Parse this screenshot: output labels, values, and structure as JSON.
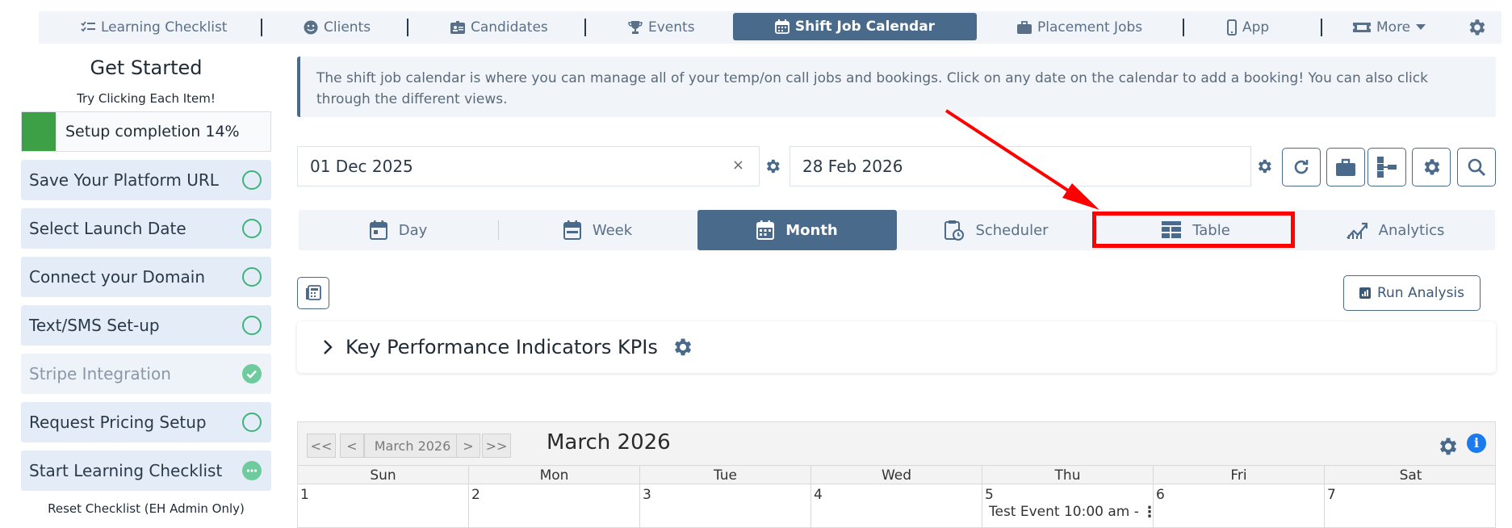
{
  "nav": {
    "items": [
      {
        "label": "Learning Checklist",
        "icon": "checklist-icon"
      },
      {
        "label": "Clients",
        "icon": "smiley-icon"
      },
      {
        "label": "Candidates",
        "icon": "id-card-icon"
      },
      {
        "label": "Events",
        "icon": "trophy-icon"
      },
      {
        "label": "Shift Job Calendar",
        "icon": "calendar-icon"
      },
      {
        "label": "Placement Jobs",
        "icon": "briefcase-icon"
      },
      {
        "label": "App",
        "icon": "mobile-icon"
      },
      {
        "label": "More",
        "icon": "ticket-icon"
      }
    ]
  },
  "sidebar": {
    "title": "Get Started",
    "subtitle": "Try Clicking Each Item!",
    "setup_completion": {
      "label": "Setup completion 14%",
      "percent": 14
    },
    "items": [
      {
        "label": "Save Your Platform URL",
        "status": "pending"
      },
      {
        "label": "Select Launch Date",
        "status": "pending"
      },
      {
        "label": "Connect your Domain",
        "status": "pending"
      },
      {
        "label": "Text/SMS Set-up",
        "status": "pending"
      },
      {
        "label": "Stripe Integration",
        "status": "done"
      },
      {
        "label": "Request Pricing Setup",
        "status": "pending"
      },
      {
        "label": "Start Learning Checklist",
        "status": "in-progress"
      }
    ],
    "reset_label": "Reset Checklist (EH Admin Only)"
  },
  "info_banner": "The shift job calendar is where you can manage all of your temp/on call jobs and bookings. Click on any date on the calendar to add a booking! You can also click through the different views.",
  "dates": {
    "start": "01 Dec 2025",
    "end": "28 Feb 2026",
    "clear_symbol": "×"
  },
  "views": [
    {
      "label": "Day",
      "icon": "calendar-day-icon"
    },
    {
      "label": "Week",
      "icon": "calendar-week-icon"
    },
    {
      "label": "Month",
      "icon": "calendar-month-icon",
      "active": true
    },
    {
      "label": "Scheduler",
      "icon": "clipboard-clock-icon"
    },
    {
      "label": "Table",
      "icon": "table-icon",
      "highlighted": true
    },
    {
      "label": "Analytics",
      "icon": "chart-line-icon"
    }
  ],
  "run_analysis_label": "Run Analysis",
  "kpi": {
    "title": "Key Performance Indicators KPIs",
    "chevron": "›"
  },
  "calendar": {
    "nav": [
      "<<",
      "<",
      "March 2026",
      ">",
      ">>"
    ],
    "title": "March 2026",
    "info_symbol": "i",
    "days_of_week": [
      "Sun",
      "Mon",
      "Tue",
      "Wed",
      "Thu",
      "Fri",
      "Sat"
    ],
    "dates": [
      "1",
      "2",
      "3",
      "4",
      "5",
      "6",
      "7"
    ],
    "event": "Test Event 10:00 am -",
    "event_menu": "⋮"
  },
  "colors": {
    "accent": "#4a6a8c",
    "success": "#3da047",
    "highlight": "#ff0000",
    "info": "#1a7aee"
  }
}
